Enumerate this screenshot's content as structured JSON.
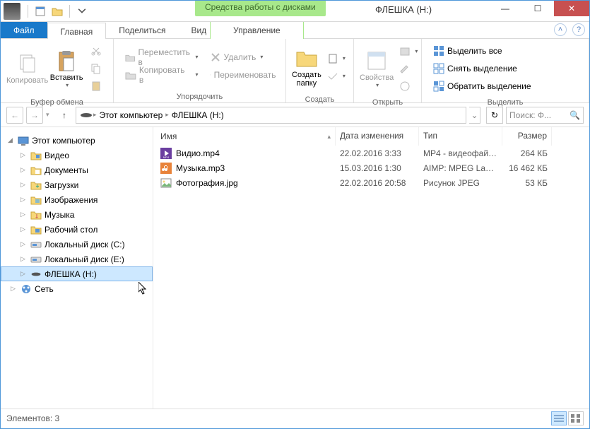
{
  "window": {
    "title": "ФЛЕШКА (H:)",
    "ribbon_context": "Средства работы с дисками"
  },
  "tabs": {
    "file": "Файл",
    "home": "Главная",
    "share": "Поделиться",
    "view": "Вид",
    "manage": "Управление"
  },
  "ribbon": {
    "clipboard": {
      "label": "Буфер обмена",
      "copy": "Копировать",
      "paste": "Вставить"
    },
    "organize": {
      "label": "Упорядочить",
      "move_to": "Переместить в",
      "copy_to": "Копировать в",
      "delete": "Удалить",
      "rename": "Переименовать"
    },
    "new": {
      "label": "Создать",
      "folder": "Создать папку"
    },
    "open": {
      "label": "Открыть",
      "properties": "Свойства"
    },
    "select": {
      "label": "Выделить",
      "all": "Выделить все",
      "none": "Снять выделение",
      "invert": "Обратить выделение"
    }
  },
  "breadcrumb": {
    "seg1": "Этот компьютер",
    "seg2": "ФЛЕШКА (H:)"
  },
  "search": {
    "placeholder": "Поиск: Ф..."
  },
  "tree": {
    "root": "Этот компьютер",
    "items": [
      "Видео",
      "Документы",
      "Загрузки",
      "Изображения",
      "Музыка",
      "Рабочий стол",
      "Локальный диск (C:)",
      "Локальный диск (E:)",
      "ФЛЕШКА (H:)"
    ],
    "network": "Сеть"
  },
  "columns": {
    "name": "Имя",
    "date": "Дата изменения",
    "type": "Тип",
    "size": "Размер"
  },
  "files": [
    {
      "name": "Видио.mp4",
      "date": "22.02.2016 3:33",
      "type": "MP4 - видеофайл...",
      "size": "264 КБ",
      "icon": "video"
    },
    {
      "name": "Музыка.mp3",
      "date": "15.03.2016 1:30",
      "type": "AIMP: MPEG Laye...",
      "size": "16 462 КБ",
      "icon": "audio"
    },
    {
      "name": "Фотография.jpg",
      "date": "22.02.2016 20:58",
      "type": "Рисунок JPEG",
      "size": "53 КБ",
      "icon": "image"
    }
  ],
  "status": {
    "count": "Элементов: 3"
  }
}
